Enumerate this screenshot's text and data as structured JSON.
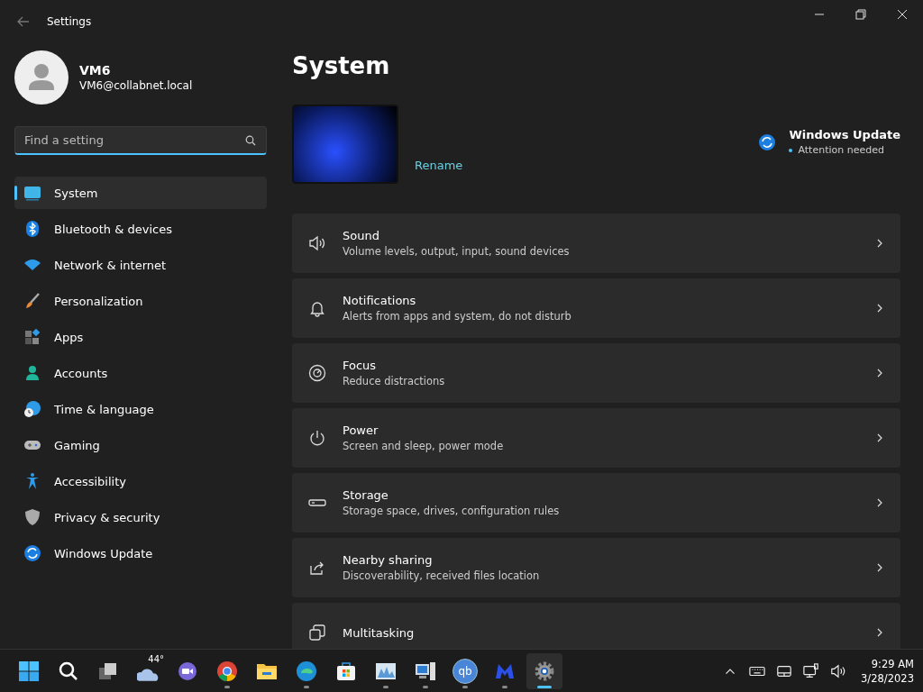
{
  "window": {
    "title": "Settings"
  },
  "account": {
    "name": "VM6",
    "email": "VM6@collabnet.local"
  },
  "search": {
    "placeholder": "Find a setting"
  },
  "nav": [
    {
      "label": "System",
      "selected": true
    },
    {
      "label": "Bluetooth & devices",
      "selected": false
    },
    {
      "label": "Network & internet",
      "selected": false
    },
    {
      "label": "Personalization",
      "selected": false
    },
    {
      "label": "Apps",
      "selected": false
    },
    {
      "label": "Accounts",
      "selected": false
    },
    {
      "label": "Time & language",
      "selected": false
    },
    {
      "label": "Gaming",
      "selected": false
    },
    {
      "label": "Accessibility",
      "selected": false
    },
    {
      "label": "Privacy & security",
      "selected": false
    },
    {
      "label": "Windows Update",
      "selected": false
    }
  ],
  "page": {
    "title": "System",
    "rename": "Rename",
    "update": {
      "title": "Windows Update",
      "status": "Attention needed"
    },
    "cards": [
      {
        "title": "Sound",
        "description": "Volume levels, output, input, sound devices"
      },
      {
        "title": "Notifications",
        "description": "Alerts from apps and system, do not disturb"
      },
      {
        "title": "Focus",
        "description": "Reduce distractions"
      },
      {
        "title": "Power",
        "description": "Screen and sleep, power mode"
      },
      {
        "title": "Storage",
        "description": "Storage space, drives, configuration rules"
      },
      {
        "title": "Nearby sharing",
        "description": "Discoverability, received files location"
      },
      {
        "title": "Multitasking"
      }
    ]
  },
  "taskbar": {
    "apps": [
      {
        "running": false,
        "selected": false
      },
      {
        "running": false,
        "selected": false
      },
      {
        "running": false,
        "selected": false
      },
      {
        "badge": "44°",
        "running": false,
        "selected": false
      },
      {
        "running": false,
        "selected": false
      },
      {
        "running": true,
        "selected": false
      },
      {
        "running": false,
        "selected": false
      },
      {
        "running": true,
        "selected": false
      },
      {
        "running": false,
        "selected": false
      },
      {
        "running": true,
        "selected": false
      },
      {
        "running": true,
        "selected": false
      },
      {
        "glyph": "qb",
        "running": true,
        "selected": false
      },
      {
        "running": true,
        "selected": false
      },
      {
        "running": true,
        "selected": true
      }
    ],
    "time": "9:29 AM",
    "date": "3/28/2023"
  }
}
